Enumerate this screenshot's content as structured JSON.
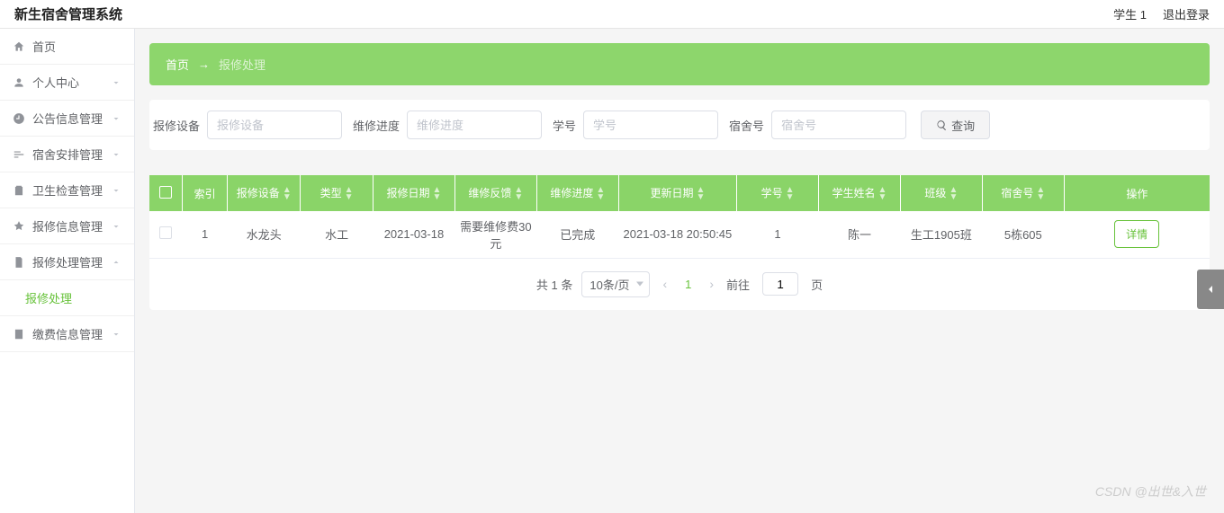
{
  "header": {
    "title": "新生宿舍管理系统",
    "user": "学生 1",
    "logout": "退出登录"
  },
  "sidebar": {
    "items": [
      {
        "label": "首页",
        "icon": "home"
      },
      {
        "label": "个人中心",
        "icon": "user"
      },
      {
        "label": "公告信息管理",
        "icon": "clock"
      },
      {
        "label": "宿舍安排管理",
        "icon": "sliders"
      },
      {
        "label": "卫生检查管理",
        "icon": "clipboard"
      },
      {
        "label": "报修信息管理",
        "icon": "pin"
      },
      {
        "label": "报修处理管理",
        "icon": "doc",
        "expanded": true
      },
      {
        "label": "缴费信息管理",
        "icon": "note"
      }
    ],
    "sub_repair": "报修处理"
  },
  "breadcrumb": {
    "home": "首页",
    "sep": "→",
    "current": "报修处理"
  },
  "search": {
    "f1_label": "报修设备",
    "f1_ph": "报修设备",
    "f2_label": "维修进度",
    "f2_ph": "维修进度",
    "f3_label": "学号",
    "f3_ph": "学号",
    "f4_label": "宿舍号",
    "f4_ph": "宿舍号",
    "query": "查询"
  },
  "table": {
    "headers": [
      "索引",
      "报修设备",
      "类型",
      "报修日期",
      "维修反馈",
      "维修进度",
      "更新日期",
      "学号",
      "学生姓名",
      "班级",
      "宿舍号",
      "操作"
    ],
    "rows": [
      {
        "idx": "1",
        "equip": "水龙头",
        "type": "水工",
        "rdate": "2021-03-18",
        "feedback": "需要维修费30元",
        "progress": "已完成",
        "udate": "2021-03-18 20:50:45",
        "sno": "1",
        "sname": "陈一",
        "class": "生工1905班",
        "dorm": "5栋605"
      }
    ],
    "detail_btn": "详情"
  },
  "pagination": {
    "total": "共 1 条",
    "per_page": "10条/页",
    "current": "1",
    "goto_prefix": "前往",
    "goto_value": "1",
    "goto_suffix": "页"
  },
  "watermark": "CSDN @出世&入世"
}
